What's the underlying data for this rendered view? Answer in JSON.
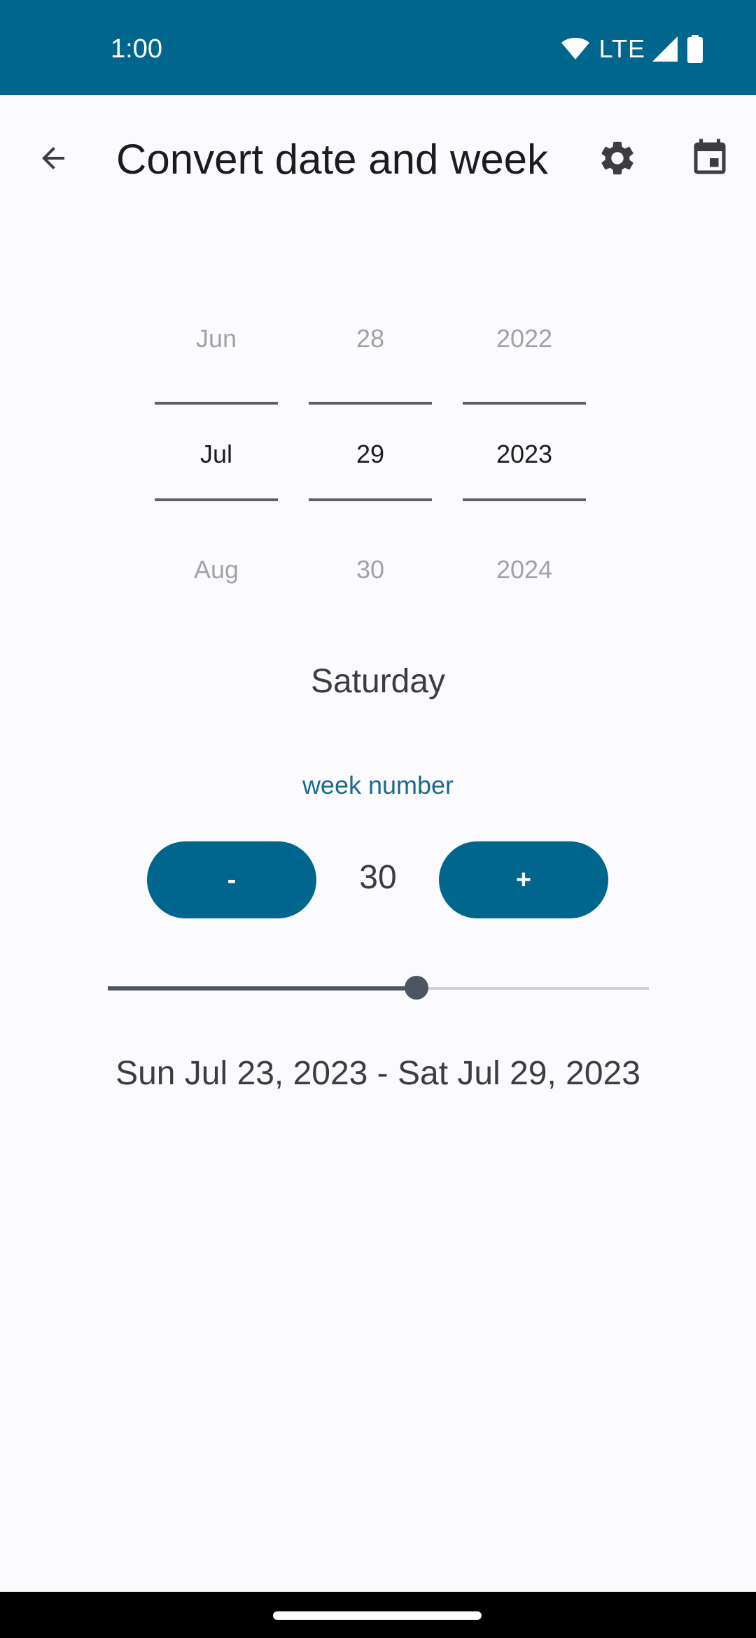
{
  "status_bar": {
    "time": "1:00",
    "network": "LTE",
    "icons": [
      "wifi-icon",
      "signal-icon",
      "battery-icon"
    ]
  },
  "app_bar": {
    "title": "Convert date and week",
    "icons": [
      "arrow-back-icon",
      "settings-gear-icon",
      "calendar-icon"
    ]
  },
  "date_picker": {
    "month": {
      "prev": "Jun",
      "current": "Jul",
      "next": "Aug"
    },
    "day": {
      "prev": "28",
      "current": "29",
      "next": "30"
    },
    "year": {
      "prev": "2022",
      "current": "2023",
      "next": "2024"
    }
  },
  "weekday": "Saturday",
  "week": {
    "label": "week number",
    "value": "30",
    "decrement_label": "-",
    "increment_label": "+",
    "slider_fraction": 0.57
  },
  "week_range": "Sun Jul 23, 2023 - Sat Jul 29, 2023",
  "colors": {
    "primary": "#01668d",
    "background": "#fbfbfe",
    "accent_text": "#1a6a8b",
    "slider_active": "#4d5660",
    "slider_inactive": "#cfd0d2"
  }
}
